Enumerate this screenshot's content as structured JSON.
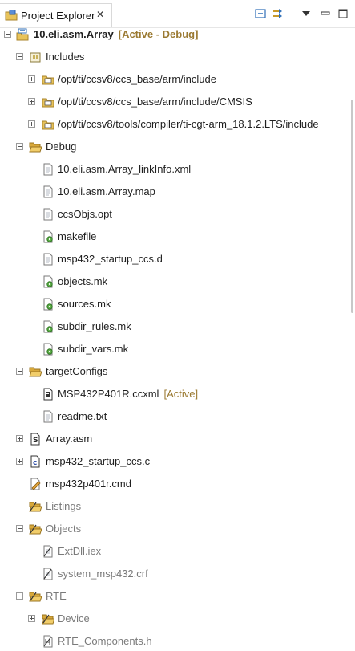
{
  "view": {
    "tab_title": "Project Explorer",
    "close_glyph": "✕",
    "toolbar": [
      "collapse-all-icon",
      "link-with-editor-icon",
      "view-menu-icon",
      "minimize-icon",
      "maximize-icon"
    ]
  },
  "tree": [
    {
      "label": "10.eli.asm.Array",
      "decoration": "[Active - Debug]",
      "icon": "ccs-project-icon",
      "expanded": true,
      "depth": 0
    },
    {
      "label": "Includes",
      "icon": "includes-icon",
      "expanded": true,
      "depth": 1
    },
    {
      "label": "/opt/ti/ccsv8/ccs_base/arm/include",
      "icon": "include-folder-icon",
      "expanded": false,
      "depth": 2
    },
    {
      "label": "/opt/ti/ccsv8/ccs_base/arm/include/CMSIS",
      "icon": "include-folder-icon",
      "expanded": false,
      "depth": 2
    },
    {
      "label": "/opt/ti/ccsv8/tools/compiler/ti-cgt-arm_18.1.2.LTS/include",
      "icon": "include-folder-icon",
      "expanded": false,
      "depth": 2
    },
    {
      "label": "Debug",
      "icon": "folder-open-icon",
      "expanded": true,
      "depth": 1
    },
    {
      "label": "10.eli.asm.Array_linkInfo.xml",
      "icon": "file-icon",
      "depth": 2
    },
    {
      "label": "10.eli.asm.Array.map",
      "icon": "file-icon",
      "depth": 2
    },
    {
      "label": "ccsObjs.opt",
      "icon": "file-icon",
      "depth": 2
    },
    {
      "label": "makefile",
      "icon": "makefile-icon",
      "depth": 2
    },
    {
      "label": "msp432_startup_ccs.d",
      "icon": "file-icon",
      "depth": 2
    },
    {
      "label": "objects.mk",
      "icon": "makefile-icon",
      "depth": 2
    },
    {
      "label": "sources.mk",
      "icon": "makefile-icon",
      "depth": 2
    },
    {
      "label": "subdir_rules.mk",
      "icon": "makefile-icon",
      "depth": 2
    },
    {
      "label": "subdir_vars.mk",
      "icon": "makefile-icon",
      "depth": 2
    },
    {
      "label": "targetConfigs",
      "icon": "folder-open-icon",
      "expanded": true,
      "depth": 1
    },
    {
      "label": "MSP432P401R.ccxml",
      "decoration": "[Active]",
      "icon": "ccxml-icon",
      "depth": 2
    },
    {
      "label": "readme.txt",
      "icon": "file-icon",
      "depth": 2
    },
    {
      "label": "Array.asm",
      "icon": "asm-file-icon",
      "expanded": false,
      "depth": 1
    },
    {
      "label": "msp432_startup_ccs.c",
      "icon": "c-file-icon",
      "expanded": false,
      "depth": 1
    },
    {
      "label": "msp432p401r.cmd",
      "icon": "cmd-file-icon",
      "depth": 1
    },
    {
      "label": "Listings",
      "icon": "excluded-folder-icon",
      "depth": 1,
      "dim": true
    },
    {
      "label": "Objects",
      "icon": "excluded-folder-icon",
      "expanded": true,
      "depth": 1,
      "dim": true
    },
    {
      "label": "ExtDll.iex",
      "icon": "excluded-file-icon",
      "depth": 2,
      "dim": true
    },
    {
      "label": "system_msp432.crf",
      "icon": "excluded-file-icon",
      "depth": 2,
      "dim": true
    },
    {
      "label": "RTE",
      "icon": "excluded-folder-icon",
      "expanded": true,
      "depth": 1,
      "dim": true
    },
    {
      "label": "Device",
      "icon": "excluded-folder-icon",
      "expanded": false,
      "depth": 2,
      "dim": true
    },
    {
      "label": "RTE_Components.h",
      "icon": "header-file-icon",
      "depth": 2,
      "dim": true
    }
  ]
}
